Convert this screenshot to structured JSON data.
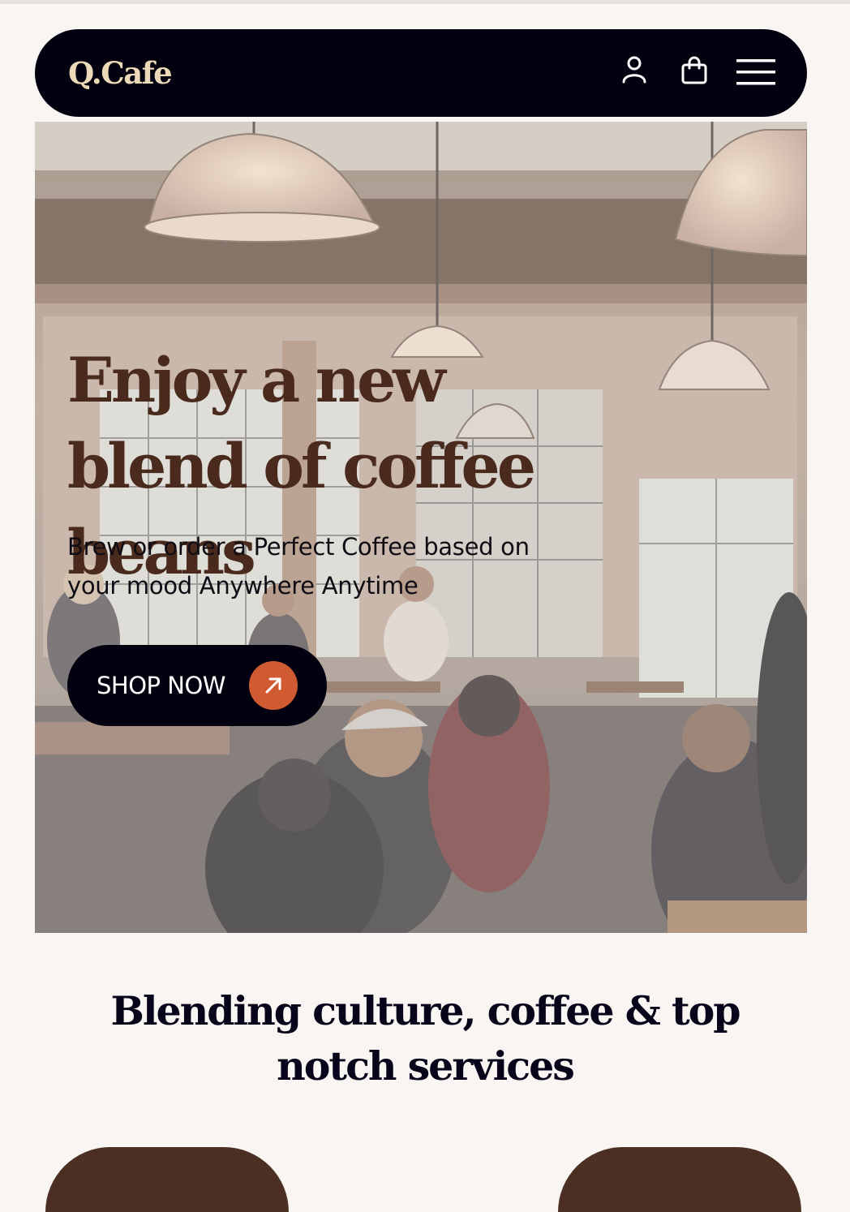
{
  "header": {
    "logo": "Q.Cafe",
    "icons": [
      "user-icon",
      "shopping-bag-icon",
      "menu-icon"
    ]
  },
  "hero": {
    "title": "Enjoy a new blend of coffee beans",
    "subtitle": "Brew or order a Perfect Coffee based on your mood Anywhere Anytime",
    "cta_label": "SHOP NOW",
    "cta_icon": "arrow-up-right-icon"
  },
  "section": {
    "title": "Blending culture, coffee & top notch services"
  },
  "colors": {
    "nav_background": "#03000f",
    "logo": "#ecd9b7",
    "hero_title": "#4a2a1d",
    "accent": "#d05a31",
    "page_background": "#f8f5f2"
  }
}
